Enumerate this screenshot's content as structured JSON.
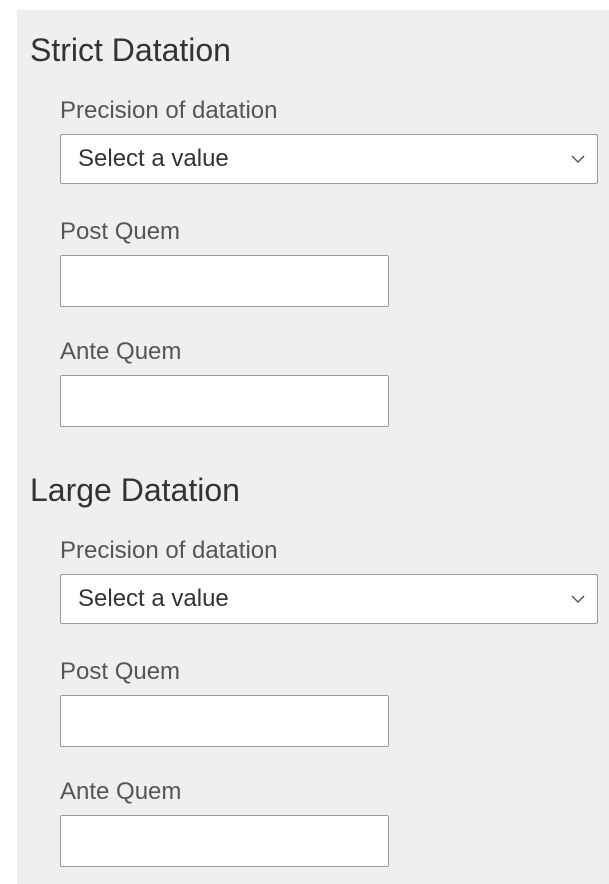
{
  "sections": [
    {
      "title": "Strict Datation",
      "precision_label": "Precision of datation",
      "precision_value": "Select a value",
      "post_quem_label": "Post Quem",
      "post_quem_value": "",
      "ante_quem_label": "Ante Quem",
      "ante_quem_value": ""
    },
    {
      "title": "Large Datation",
      "precision_label": "Precision of datation",
      "precision_value": "Select a value",
      "post_quem_label": "Post Quem",
      "post_quem_value": "",
      "ante_quem_label": "Ante Quem",
      "ante_quem_value": ""
    }
  ],
  "icons": {
    "select_arrow": "chevron-down-icon"
  },
  "colors": {
    "panel_background": "#efefef",
    "field_background": "#ffffff",
    "field_border": "#9a9a9a",
    "title_text": "#333333",
    "label_text": "#555555"
  }
}
